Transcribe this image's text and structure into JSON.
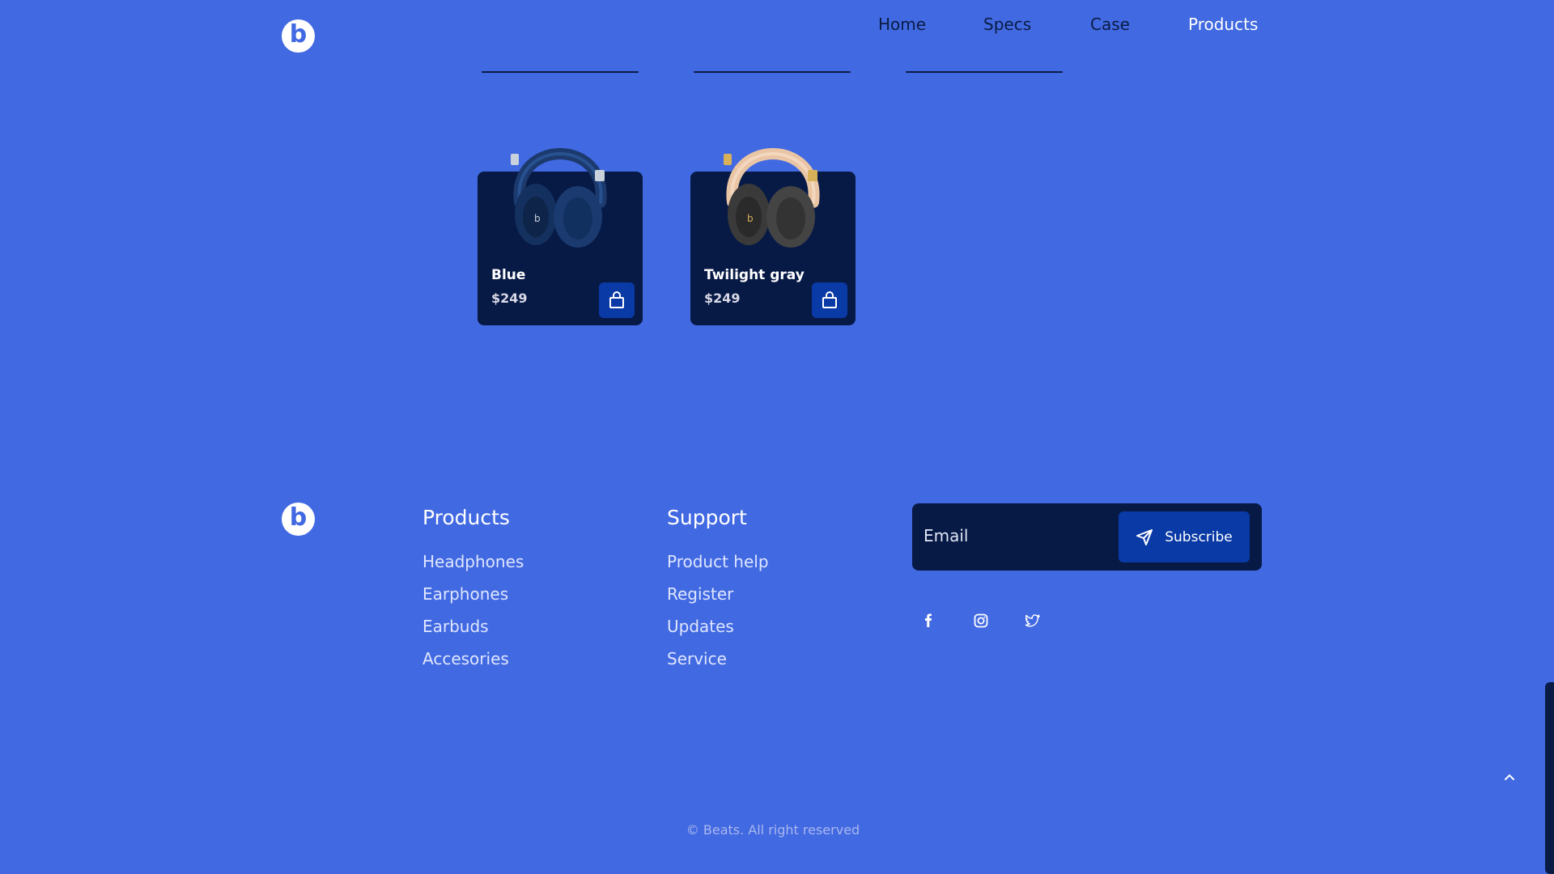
{
  "brand": {
    "logo_letter": "b"
  },
  "nav": {
    "items": [
      {
        "label": "Home"
      },
      {
        "label": "Specs"
      },
      {
        "label": "Case"
      },
      {
        "label": "Products"
      }
    ],
    "active": "Products"
  },
  "products": [
    {
      "name": "Blue",
      "price": "$249",
      "color": "#1c3a6e"
    },
    {
      "name": "Twilight gray",
      "price": "$249",
      "color": "#3a3a3a"
    }
  ],
  "footer": {
    "products": {
      "title": "Products",
      "links": [
        "Headphones",
        "Earphones",
        "Earbuds",
        "Accesories"
      ]
    },
    "support": {
      "title": "Support",
      "links": [
        "Product help",
        "Register",
        "Updates",
        "Service"
      ]
    },
    "subscribe": {
      "placeholder": "Email",
      "button_label": "Subscribe"
    },
    "social": [
      "facebook-icon",
      "instagram-icon",
      "twitter-icon"
    ],
    "copyright": "© Beats. All right reserved"
  },
  "colors": {
    "background": "#4169e1",
    "card": "#071a45",
    "accent": "#0a3aa6",
    "nav_text": "#0a1c45"
  }
}
